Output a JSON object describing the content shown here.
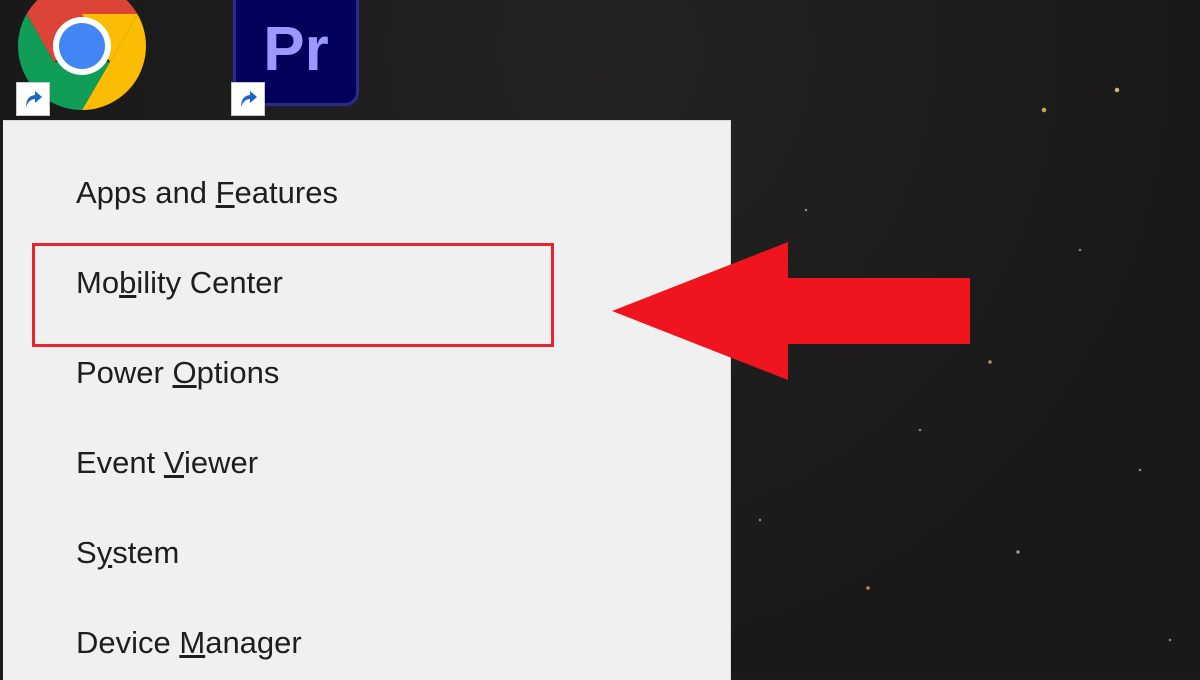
{
  "desktop": {
    "icons": [
      {
        "name": "chrome-icon",
        "shortcut": true
      },
      {
        "name": "premiere-pro-icon",
        "label": "Pr",
        "shortcut": true
      }
    ]
  },
  "menu": {
    "items": [
      {
        "label": "Apps and Features",
        "access_key": "F"
      },
      {
        "label": "Mobility Center",
        "access_key": "b",
        "highlighted": true
      },
      {
        "label": "Power Options",
        "access_key": "O"
      },
      {
        "label": "Event Viewer",
        "access_key": "V"
      },
      {
        "label": "System",
        "access_key": "y"
      },
      {
        "label": "Device Manager",
        "access_key": "M"
      }
    ]
  },
  "annotation": {
    "highlight_color": "#e8242f",
    "arrow_color": "#f0141e",
    "points_to": "Mobility Center"
  }
}
